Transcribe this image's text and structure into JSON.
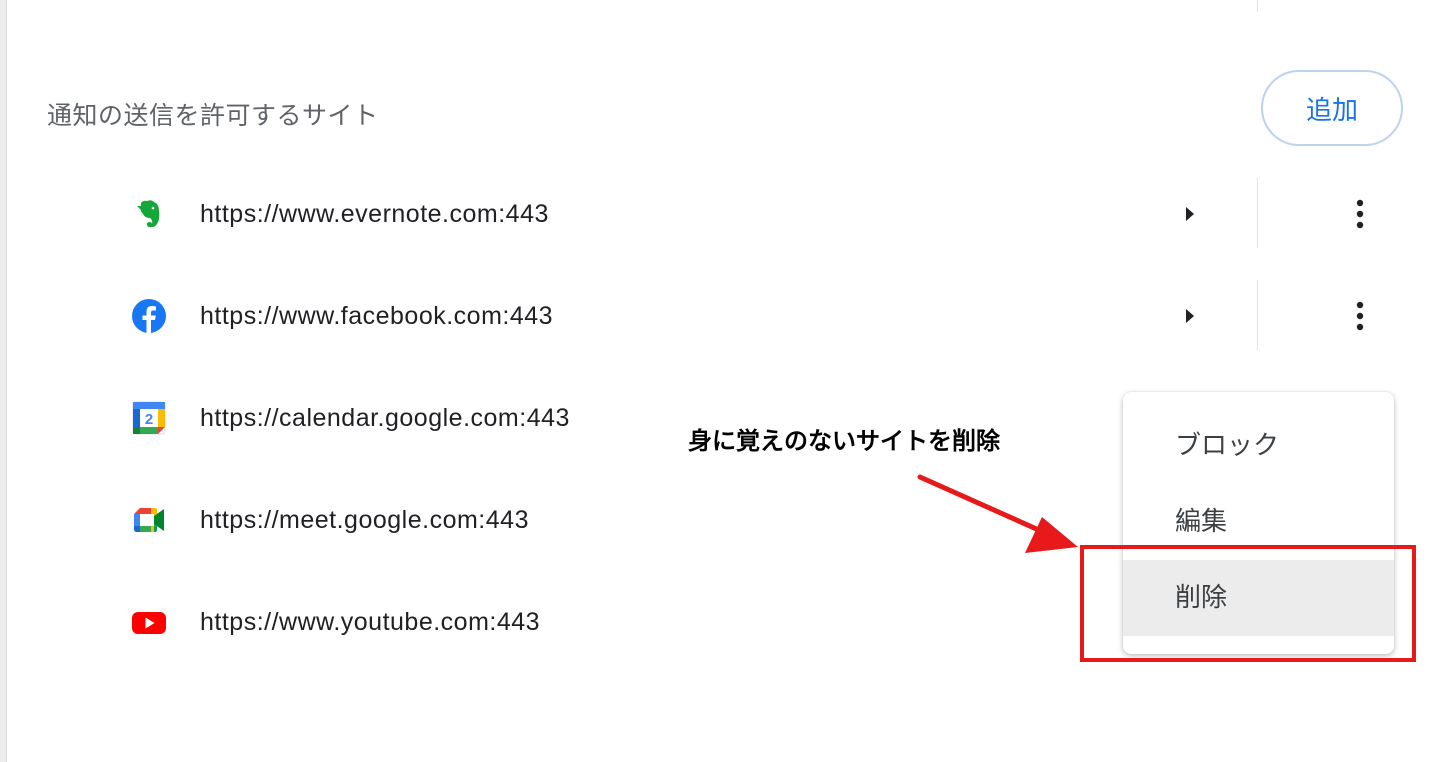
{
  "section": {
    "title": "通知の送信を許可するサイト",
    "add_label": "追加"
  },
  "sites": [
    {
      "url": "https://www.evernote.com:443",
      "icon": "evernote-icon",
      "has_actions": true
    },
    {
      "url": "https://www.facebook.com:443",
      "icon": "facebook-icon",
      "has_actions": true
    },
    {
      "url": "https://calendar.google.com:443",
      "icon": "google-calendar-icon",
      "calendar_day": "2",
      "has_actions": false
    },
    {
      "url": "https://meet.google.com:443",
      "icon": "google-meet-icon",
      "has_actions": false
    },
    {
      "url": "https://www.youtube.com:443",
      "icon": "youtube-icon",
      "has_actions": false
    }
  ],
  "context_menu": {
    "items": [
      {
        "label": "ブロック",
        "hovered": false
      },
      {
        "label": "編集",
        "hovered": false
      },
      {
        "label": "削除",
        "hovered": true
      }
    ]
  },
  "annotation": {
    "text": "身に覚えのないサイトを削除",
    "color": "#e8191a"
  },
  "colors": {
    "accent": "#1a73e8",
    "evernote": "#14a83a",
    "facebook": "#1877f2",
    "youtube": "#ff0000"
  }
}
